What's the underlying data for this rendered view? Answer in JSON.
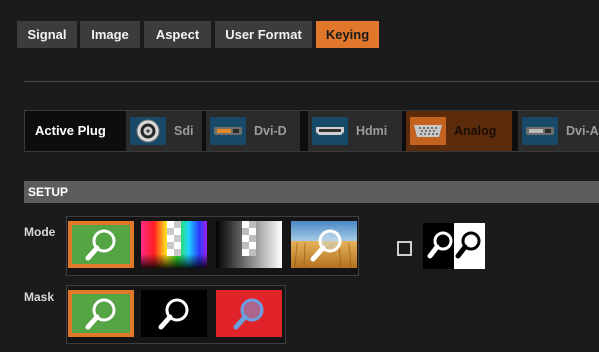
{
  "tabs": [
    {
      "label": "Signal",
      "active": false
    },
    {
      "label": "Image",
      "active": false
    },
    {
      "label": "Aspect",
      "active": false
    },
    {
      "label": "User Format",
      "active": false
    },
    {
      "label": "Keying",
      "active": true
    }
  ],
  "active_plug": {
    "label": "Active Plug",
    "plugs": [
      {
        "label": "Sdi",
        "icon": "bnc-connector-icon",
        "active": false
      },
      {
        "label": "Dvi-D",
        "icon": "dvi-connector-icon",
        "active": false
      },
      {
        "label": "Hdmi",
        "icon": "hdmi-connector-icon",
        "active": false
      },
      {
        "label": "Analog",
        "icon": "vga-connector-icon",
        "active": true
      },
      {
        "label": "Dvi-A",
        "icon": "dvi-connector-icon",
        "active": false
      }
    ]
  },
  "setup": {
    "title": "SETUP",
    "mode": {
      "label": "Mode",
      "options": [
        {
          "icon": "magnifier-on-green-icon",
          "selected": true
        },
        {
          "icon": "color-bars-icon",
          "selected": false
        },
        {
          "icon": "gradient-checker-icon",
          "selected": false
        },
        {
          "icon": "magnifier-on-photo-icon",
          "selected": false
        }
      ],
      "invert_checked": false,
      "invert_icon": "magnifier-black-white-icon"
    },
    "mask": {
      "label": "Mask",
      "options": [
        {
          "icon": "magnifier-on-green-icon",
          "selected": true
        },
        {
          "icon": "magnifier-on-black-icon",
          "selected": false
        },
        {
          "icon": "magnifier-on-red-icon",
          "selected": false
        }
      ]
    }
  },
  "colors": {
    "accent": "#e0772b",
    "tab_bg": "#3c3c3c",
    "plug_icon_bg": "#164a66",
    "setup_bar": "#5c5c5c",
    "green_keyer": "#55a545",
    "red_keyer": "#e0242a"
  }
}
